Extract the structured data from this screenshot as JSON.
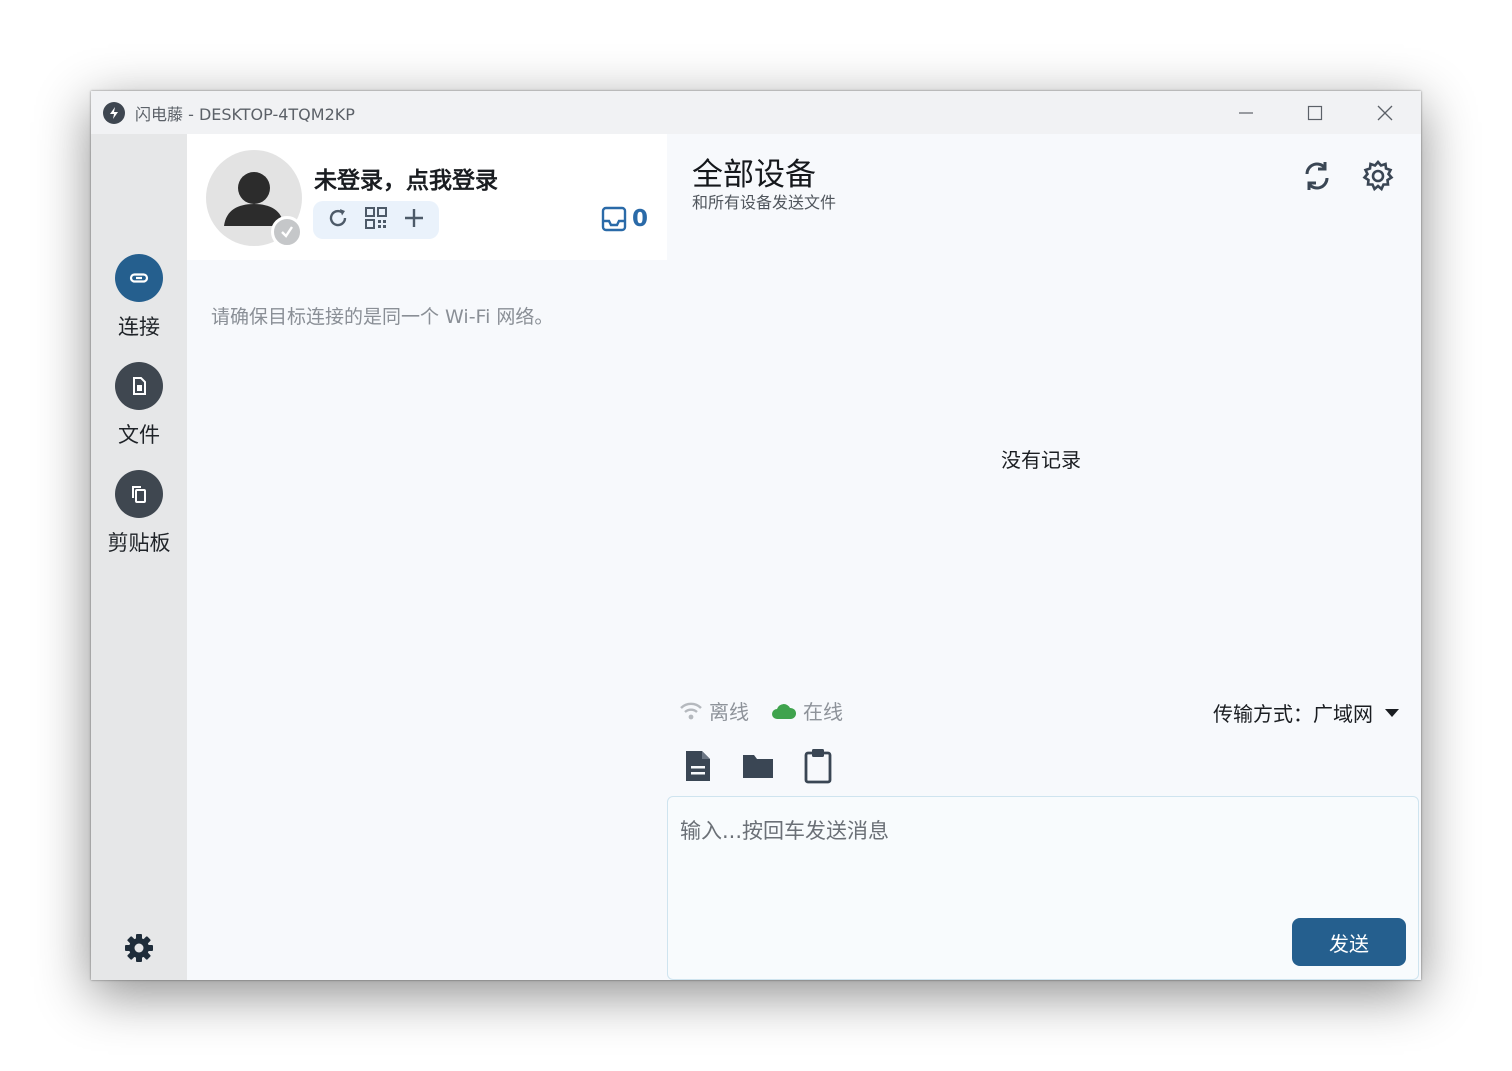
{
  "window": {
    "title": "闪电藤 - DESKTOP-4TQM2KP"
  },
  "nav": {
    "items": [
      {
        "label": "连接",
        "icon": "link-icon",
        "active": true
      },
      {
        "label": "文件",
        "icon": "file-icon",
        "active": false
      },
      {
        "label": "剪贴板",
        "icon": "clipboard-copy-icon",
        "active": false
      }
    ],
    "settings_icon": "gear-icon"
  },
  "profile": {
    "login_text": "未登录，点我登录",
    "inbox_count": "0",
    "actions": [
      "refresh-icon",
      "qr-code-icon",
      "plus-icon"
    ]
  },
  "connect": {
    "hint": "请确保目标连接的是同一个 Wi-Fi 网络。"
  },
  "main": {
    "title": "全部设备",
    "subtitle": "和所有设备发送文件",
    "empty_text": "没有记录",
    "status": {
      "offline_label": "离线",
      "online_label": "在线"
    },
    "transfer": {
      "label": "传输方式：",
      "value": "广域网"
    },
    "tools": [
      "document-icon",
      "folder-icon",
      "clipboard-icon"
    ],
    "input_placeholder": "输入...按回车发送消息",
    "send_label": "发送"
  },
  "colors": {
    "accent": "#255f8e",
    "online": "#3fa34d",
    "rail_bg": "#e6e7e8"
  }
}
